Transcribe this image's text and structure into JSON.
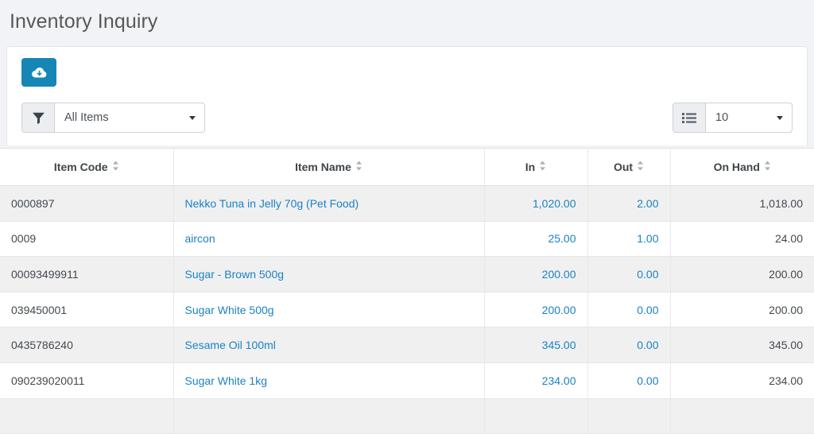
{
  "page": {
    "title": "Inventory Inquiry"
  },
  "toolbar": {
    "export_button": {
      "icon": "cloud-download-icon",
      "label": "",
      "color": "#1686b6"
    }
  },
  "filter": {
    "icon": "filter-funnel-icon",
    "selected": "All Items",
    "options": [
      "All Items"
    ]
  },
  "page_size": {
    "icon": "list-icon",
    "selected": "10",
    "options": [
      "10"
    ]
  },
  "table": {
    "columns": [
      {
        "label": "Item Code",
        "sortable": true,
        "align": "left"
      },
      {
        "label": "Item Name",
        "sortable": true,
        "align": "left"
      },
      {
        "label": "In",
        "sortable": true,
        "align": "right"
      },
      {
        "label": "Out",
        "sortable": true,
        "align": "right"
      },
      {
        "label": "On Hand",
        "sortable": true,
        "align": "right"
      }
    ],
    "rows": [
      {
        "item_code": "0000897",
        "item_name": "Nekko Tuna in Jelly 70g (Pet Food)",
        "in": "1,020.00",
        "out": "2.00",
        "on_hand": "1,018.00"
      },
      {
        "item_code": "0009",
        "item_name": "aircon",
        "in": "25.00",
        "out": "1.00",
        "on_hand": "24.00"
      },
      {
        "item_code": "00093499911",
        "item_name": "Sugar - Brown 500g",
        "in": "200.00",
        "out": "0.00",
        "on_hand": "200.00"
      },
      {
        "item_code": "039450001",
        "item_name": "Sugar White 500g",
        "in": "200.00",
        "out": "0.00",
        "on_hand": "200.00"
      },
      {
        "item_code": "0435786240",
        "item_name": "Sesame Oil 100ml",
        "in": "345.00",
        "out": "0.00",
        "on_hand": "345.00"
      },
      {
        "item_code": "090239020011",
        "item_name": "Sugar White 1kg",
        "in": "234.00",
        "out": "0.00",
        "on_hand": "234.00"
      }
    ]
  },
  "colors": {
    "accent": "#1686b6",
    "link": "#1a82c4",
    "page_background": "#f1f3f6",
    "row_stripe": "#f0f0f1",
    "text": "#43494e"
  }
}
